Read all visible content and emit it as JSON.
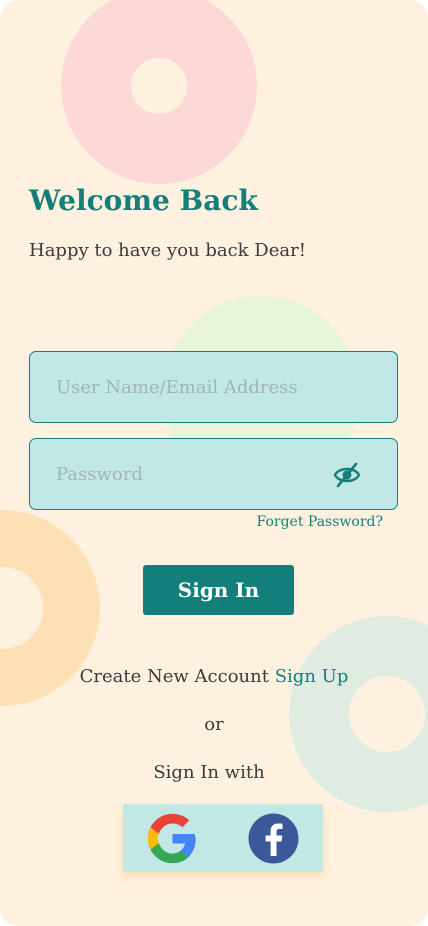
{
  "header": {
    "title": "Welcome Back",
    "subtitle": "Happy to have you back Dear!"
  },
  "form": {
    "username_placeholder": "User Name/Email Address",
    "username_value": "",
    "password_placeholder": "Password",
    "password_value": "",
    "password_toggle_icon": "eye-off-icon",
    "forgot_label": "Forget Password?",
    "submit_label": "Sign In"
  },
  "footer": {
    "create_text": "Create New Account",
    "signup_label": "Sign Up",
    "or_text": "or",
    "social_title": "Sign In with",
    "social_icons": [
      "google-icon",
      "facebook-icon"
    ]
  },
  "colors": {
    "background": "#fff1df",
    "accent": "#137f7b",
    "field_fill": "#c2e8e6",
    "text": "#3a3a3a",
    "ring_pink": "#fcd8d6",
    "ring_green": "#e8f4d8",
    "ring_orange": "#fde0b6",
    "ring_teal": "#e0ebe2"
  }
}
